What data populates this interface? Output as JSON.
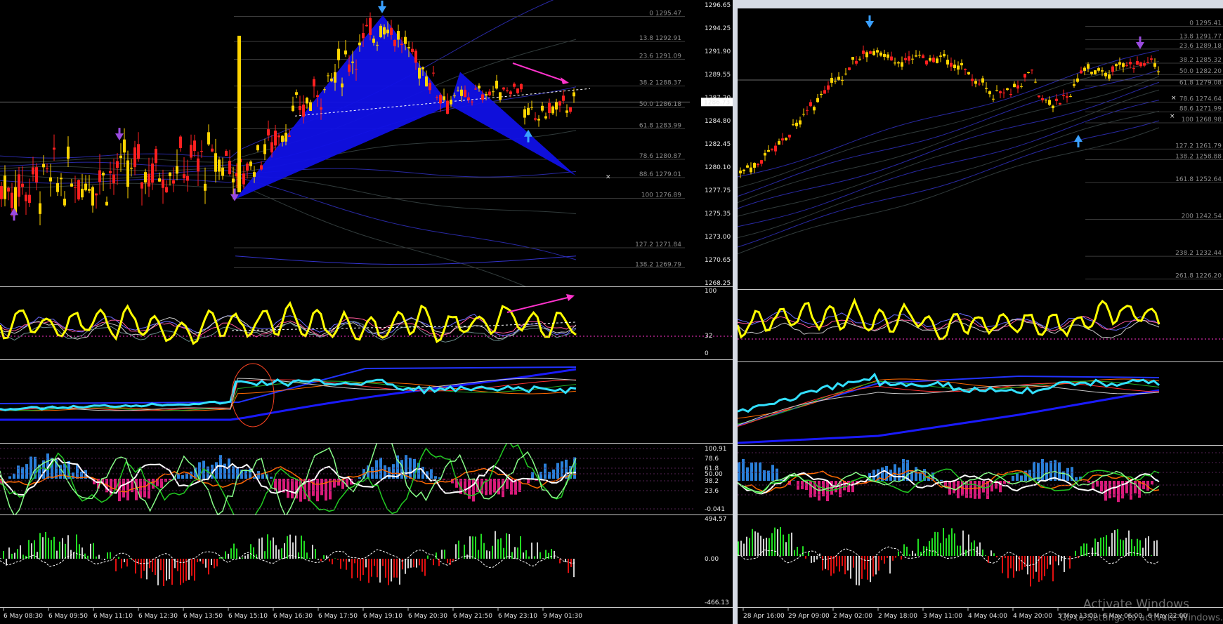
{
  "colors": {
    "background": "#000000",
    "candle_up": "#ffd400",
    "candle_down": "#ff2020",
    "harmonic_fill": "#1010e6",
    "fib_line": "#3a3a3a",
    "band_blue": "#3333cc",
    "band_grey": "#3d4a4a",
    "rsi_line": "#ffff00",
    "ma_cyan": "#33e0ff",
    "hist_up": "#2a7fd8",
    "hist_down": "#d81b7a",
    "vol_up": "#22dd22",
    "vol_down": "#e01010",
    "arrow_up": "#3aa0ff",
    "arrow_mark": "#9a4adf",
    "trend_arrow": "#ff33cc"
  },
  "left_chart": {
    "price_axis": [
      "1296.65",
      "1294.25",
      "1291.90",
      "1289.55",
      "1287.20",
      "1284.80",
      "1282.45",
      "1280.10",
      "1277.75",
      "1275.35",
      "1273.00",
      "1270.65",
      "1268.25"
    ],
    "current_price": "1286.73",
    "fib_levels": [
      {
        "label": "0 1295.47",
        "price": 1295.47
      },
      {
        "label": "13.8 1292.91",
        "price": 1292.91
      },
      {
        "label": "23.6 1291.09",
        "price": 1291.09
      },
      {
        "label": "38.2 1288.37",
        "price": 1288.37
      },
      {
        "label": "50.0 1286.18",
        "price": 1286.18
      },
      {
        "label": "61.8 1283.99",
        "price": 1283.99
      },
      {
        "label": "78.6 1280.87",
        "price": 1280.87
      },
      {
        "label": "88.6 1279.01",
        "price": 1279.01
      },
      {
        "label": "100 1276.89",
        "price": 1276.89
      },
      {
        "label": "127.2 1271.84",
        "price": 1271.84
      },
      {
        "label": "138.2 1269.79",
        "price": 1269.79
      }
    ],
    "rsi_axis": [
      "100",
      "32",
      "0"
    ],
    "osc_axis": [
      "100.91",
      "78.6",
      "61.8",
      "50.00",
      "38.2",
      "23.6",
      "-0.041"
    ],
    "vol_axis": [
      "494.57",
      "0.00",
      "-466.13"
    ],
    "time_axis": [
      "6 May 08:30",
      "6 May 09:50",
      "6 May 11:10",
      "6 May 12:30",
      "6 May 13:50",
      "6 May 15:10",
      "6 May 16:30",
      "6 May 17:50",
      "6 May 19:10",
      "6 May 20:30",
      "6 May 21:50",
      "6 May 23:10",
      "9 May 01:30"
    ]
  },
  "right_chart": {
    "fib_levels": [
      {
        "label": "0 1295.41",
        "price": 1295.41
      },
      {
        "label": "13.8 1291.77",
        "price": 1291.77
      },
      {
        "label": "23.6 1289.18",
        "price": 1289.18
      },
      {
        "label": "38.2 1285.32",
        "price": 1285.32
      },
      {
        "label": "50.0 1282.20",
        "price": 1282.2
      },
      {
        "label": "61.8 1279.08",
        "price": 1279.08
      },
      {
        "label": "78.6 1274.64",
        "price": 1274.64
      },
      {
        "label": "88.6 1271.99",
        "price": 1271.99
      },
      {
        "label": "100 1268.98",
        "price": 1268.98
      },
      {
        "label": "127.2 1261.79",
        "price": 1261.79
      },
      {
        "label": "138.2 1258.88",
        "price": 1258.88
      },
      {
        "label": "161.8 1252.64",
        "price": 1252.64
      },
      {
        "label": "200 1242.54",
        "price": 1242.54
      },
      {
        "label": "238.2 1232.44",
        "price": 1232.44
      },
      {
        "label": "261.8 1226.20",
        "price": 1226.2
      }
    ],
    "time_axis": [
      "28 Apr 16:00",
      "29 Apr 09:00",
      "2 May 02:00",
      "2 May 18:00",
      "3 May 11:00",
      "4 May 04:00",
      "4 May 20:00",
      "5 May 13:00",
      "6 May 06:00",
      "6 May 22:00"
    ]
  },
  "watermark": {
    "line1": "Activate Windows",
    "line2": "Go to Settings to activate Windows."
  }
}
